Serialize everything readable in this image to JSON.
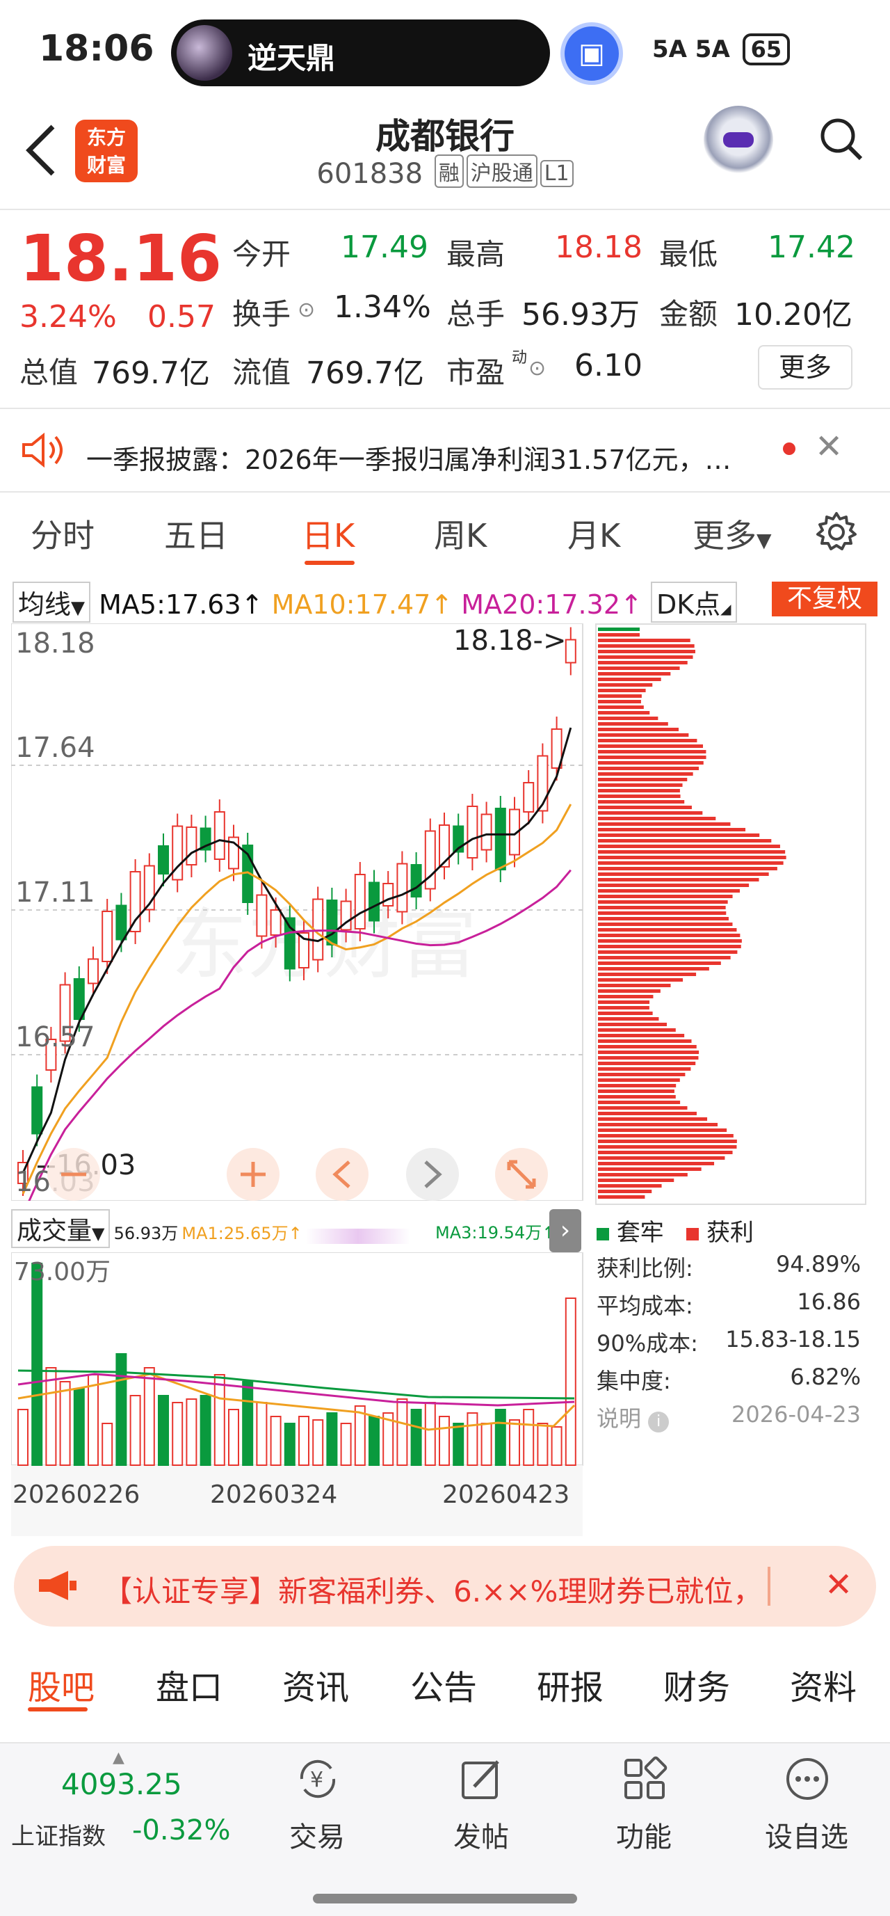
{
  "status_bar": {
    "time": "18:06",
    "pill_title": "逆天鼎",
    "signal": "5A 5A",
    "battery": "65"
  },
  "header": {
    "title": "成都银行",
    "code": "601838",
    "tags": [
      "融",
      "沪股通",
      "L1"
    ],
    "logo_text": [
      "东方",
      "财富"
    ]
  },
  "quote": {
    "price": "18.16",
    "change_pct": "3.24%",
    "change": "0.57",
    "fields": [
      {
        "label": "今开",
        "value": "17.49"
      },
      {
        "label": "最高",
        "value": "18.18"
      },
      {
        "label": "最低",
        "value": "17.42"
      },
      {
        "label": "换手",
        "value": "1.34%"
      },
      {
        "label": "总手",
        "value": "56.93万"
      },
      {
        "label": "金额",
        "value": "10.20亿"
      },
      {
        "label": "总值",
        "value": "769.7亿"
      },
      {
        "label": "流值",
        "value": "769.7亿"
      },
      {
        "label": "市盈",
        "value": "6.10"
      }
    ],
    "more_label": "更多"
  },
  "news": {
    "text": "一季报披露：2026年一季报归属净利润31.57亿元，…"
  },
  "tabs": [
    "分时",
    "五日",
    "日K",
    "周K",
    "月K",
    "更多"
  ],
  "active_tab": "日K",
  "ma_row": {
    "select": "均线",
    "ma5": "MA5:17.63",
    "ma10": "MA10:17.47",
    "ma20": "MA20:17.32",
    "dk": "DK点",
    "fq": "不复权"
  },
  "kline": {
    "y_labels": [
      "18.18",
      "17.64",
      "17.11",
      "16.57",
      "16.03"
    ],
    "max_marker": "18.18->",
    "min_marker": "--16.03",
    "colors": {
      "up": "#e8352e",
      "down": "#0a9a3e",
      "ma5": "#111111",
      "ma10": "#f0a020",
      "ma20": "#c8209a"
    }
  },
  "volume": {
    "select": "成交量",
    "vol": "56.93万",
    "ma1": "MA1:25.65万",
    "ma3": "MA3:19.54万",
    "y_max": "73.00万",
    "dates": [
      "20260226",
      "20260324",
      "20260423"
    ]
  },
  "chip": {
    "legend": [
      "套牢",
      "获利"
    ],
    "stats": [
      {
        "label": "获利比例:",
        "value": "94.89%"
      },
      {
        "label": "平均成本:",
        "value": "16.86"
      },
      {
        "label": "90%成本:",
        "value": "15.83-18.15"
      },
      {
        "label": "集中度:",
        "value": "6.82%"
      },
      {
        "label": "说明",
        "value": "2026-04-23"
      }
    ]
  },
  "promo": {
    "text": "【认证专享】新客福利券、6.××%理财券已就位，"
  },
  "subtabs": [
    "股吧",
    "盘口",
    "资讯",
    "公告",
    "研报",
    "财务",
    "资料"
  ],
  "active_subtab": "股吧",
  "bottom": {
    "index_value": "4093.25",
    "index_name": "上证指数",
    "index_change": "-0.32%",
    "items": [
      "交易",
      "发帖",
      "功能",
      "设自选"
    ]
  }
}
